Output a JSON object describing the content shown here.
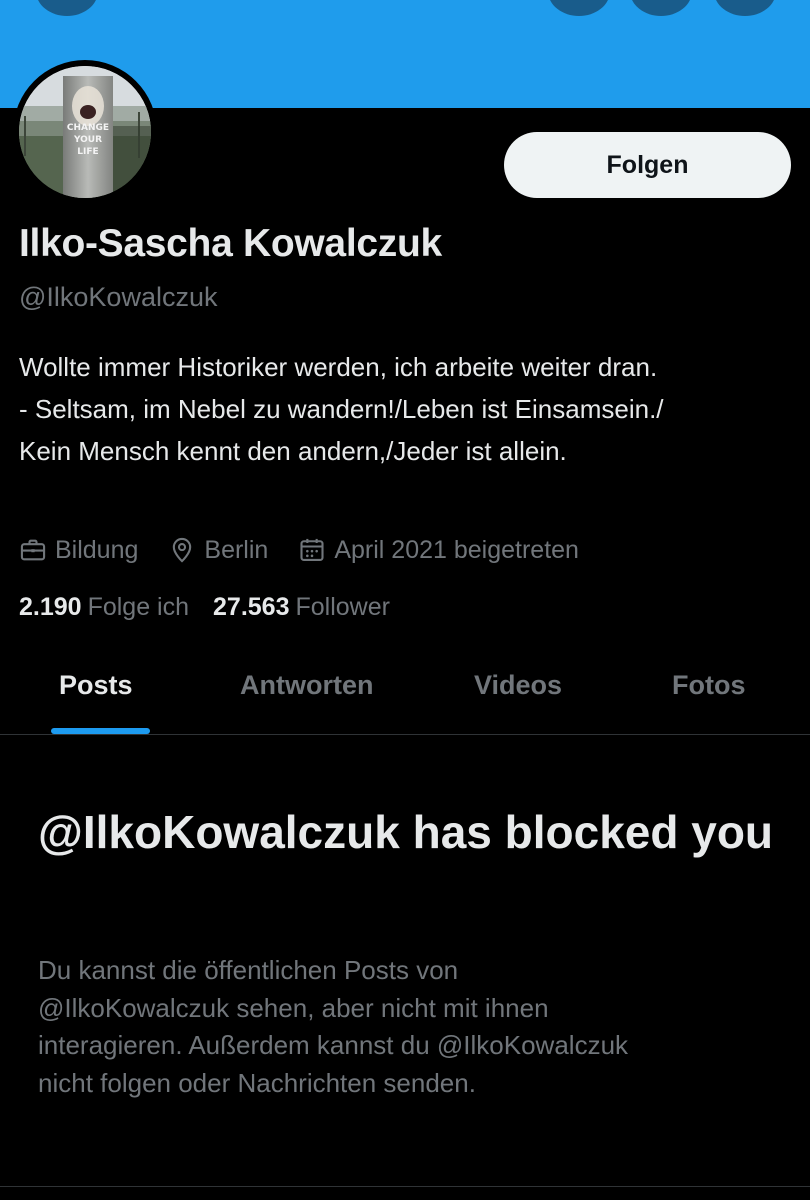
{
  "profile": {
    "follow_label": "Folgen",
    "name": "Ilko-Sascha Kowalczuk",
    "handle": "@IlkoKowalczuk",
    "bio_lines": [
      "Wollte immer Historiker werden, ich arbeite weiter dran.",
      "- Seltsam, im Nebel zu wandern!/Leben ist Einsamsein./",
      "Kein Mensch kennt den andern,/Jeder ist allein."
    ],
    "meta": {
      "category": "Bildung",
      "category_icon": "briefcase-icon",
      "location": "Berlin",
      "location_icon": "location-pin-icon",
      "joined": "April 2021 beigetreten",
      "joined_icon": "calendar-icon"
    },
    "stats": {
      "following_count": "2.190",
      "following_label": "Folge ich",
      "followers_count": "27.563",
      "followers_label": "Follower"
    },
    "avatar_text": [
      "CHANGE",
      "YOUR",
      "LIFE"
    ]
  },
  "tabs": [
    {
      "label": "Posts",
      "active": true
    },
    {
      "label": "Antworten",
      "active": false
    },
    {
      "label": "Videos",
      "active": false
    },
    {
      "label": "Fotos",
      "active": false
    }
  ],
  "blocked": {
    "title": "@IlkoKowalczuk has blocked you",
    "description_lines": [
      "Du kannst die öffentlichen Posts von",
      "@IlkoKowalczuk sehen, aber nicht mit ihnen",
      "interagieren. Außerdem kannst du @IlkoKowalczuk",
      "nicht folgen oder Nachrichten senden."
    ]
  },
  "colors": {
    "banner": "#1f9cec",
    "background": "#000000",
    "accent": "#1d9bf0",
    "muted_text": "#71767b",
    "primary_text": "#e7e9ea"
  }
}
